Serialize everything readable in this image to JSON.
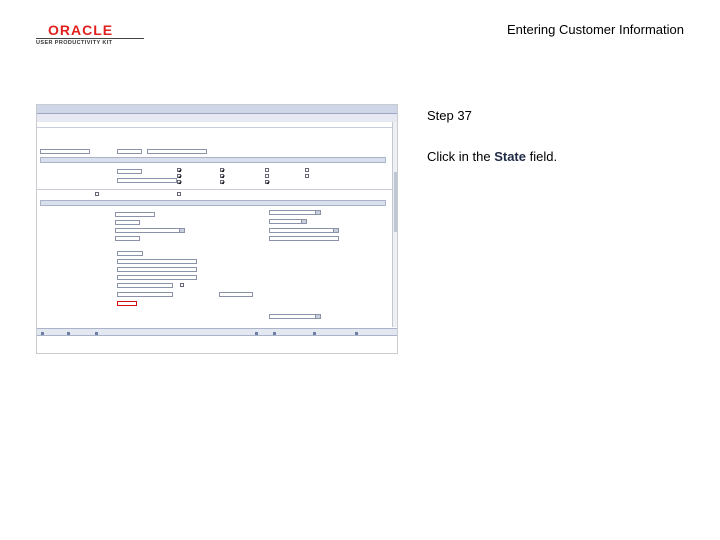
{
  "header": {
    "brand": "ORACLE",
    "product": "USER PRODUCTIVITY KIT",
    "document_title": "Entering Customer Information"
  },
  "step": {
    "label": "Step 37",
    "instruction_prefix": "Click in the",
    "field_name": "State",
    "instruction_suffix": "field."
  },
  "colors": {
    "brand_red": "#e0211d",
    "highlight": "#d01010"
  }
}
